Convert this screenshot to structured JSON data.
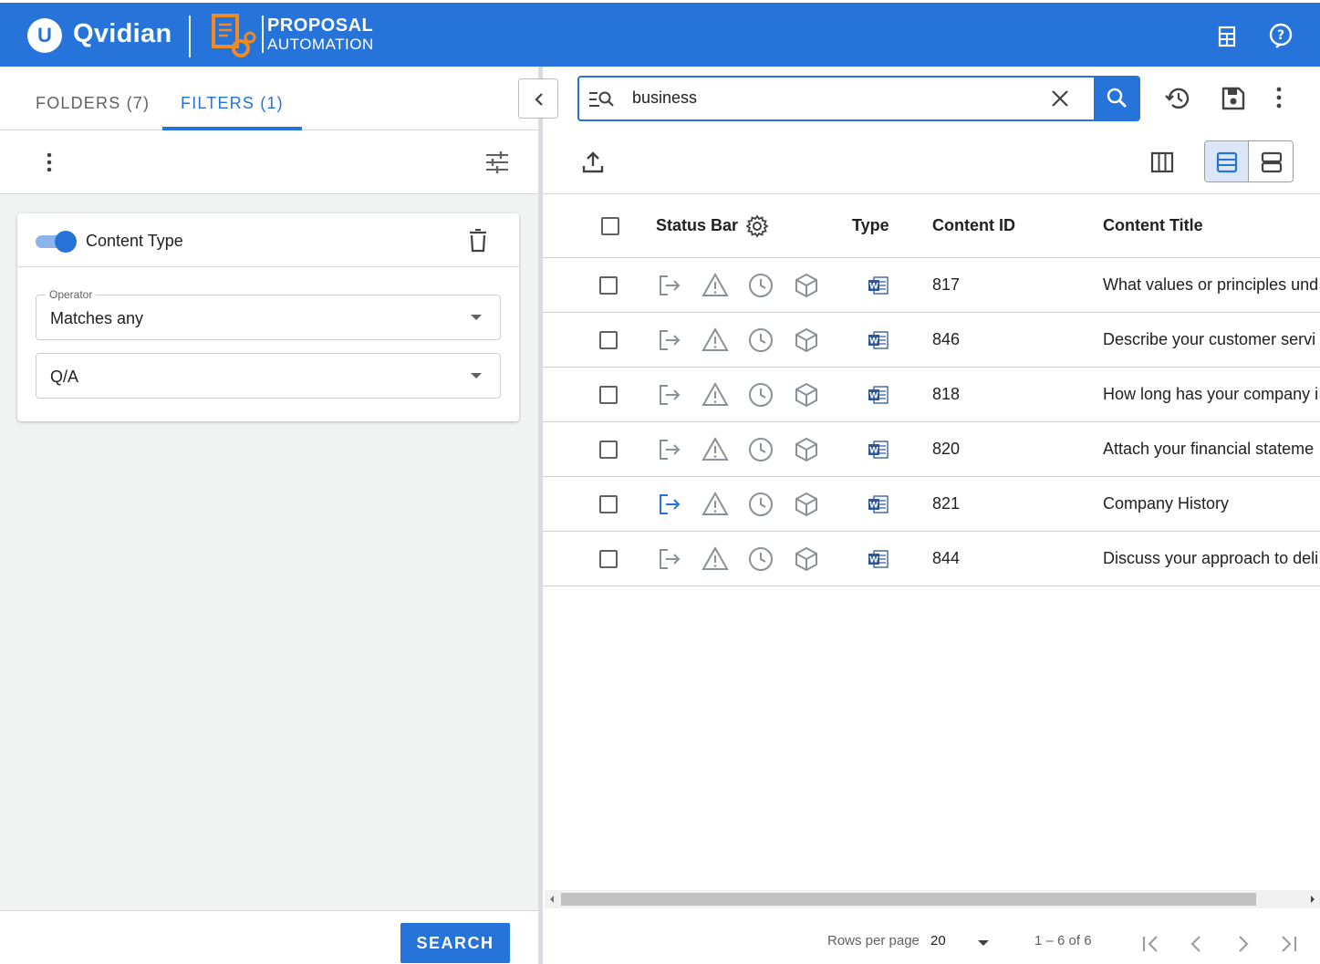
{
  "header": {
    "brand": "Qvidian",
    "logo_letter": "U",
    "product_line1": "PROPOSAL",
    "product_line2": "AUTOMATION",
    "icons": [
      "calculator-icon",
      "help-icon"
    ]
  },
  "left": {
    "tabs": [
      {
        "label": "FOLDERS (7)",
        "active": false
      },
      {
        "label": "FILTERS (1)",
        "active": true
      }
    ],
    "filter": {
      "title": "Content Type",
      "enabled": true,
      "operator_label": "Operator",
      "operator_value": "Matches any",
      "value": "Q/A"
    },
    "search_button": "SEARCH"
  },
  "right": {
    "search_query": "business",
    "columns": {
      "status": "Status Bar",
      "type": "Type",
      "id": "Content ID",
      "title": "Content Title"
    },
    "rows": [
      {
        "id": "817",
        "title": "What values or principles und",
        "checkout_active": false
      },
      {
        "id": "846",
        "title": "Describe your customer servi",
        "checkout_active": false
      },
      {
        "id": "818",
        "title": "How long has your company i",
        "checkout_active": false
      },
      {
        "id": "820",
        "title": "Attach your financial stateme",
        "checkout_active": false
      },
      {
        "id": "821",
        "title": "Company History",
        "checkout_active": true
      },
      {
        "id": "844",
        "title": "Discuss your approach to deli",
        "checkout_active": false
      }
    ],
    "pager": {
      "rows_per_page_label": "Rows per page",
      "rows_per_page": "20",
      "range": "1 – 6 of 6"
    }
  },
  "colors": {
    "primary": "#2673d9",
    "icon_gray": "#8a9199",
    "accent_orange": "#f08a24"
  }
}
